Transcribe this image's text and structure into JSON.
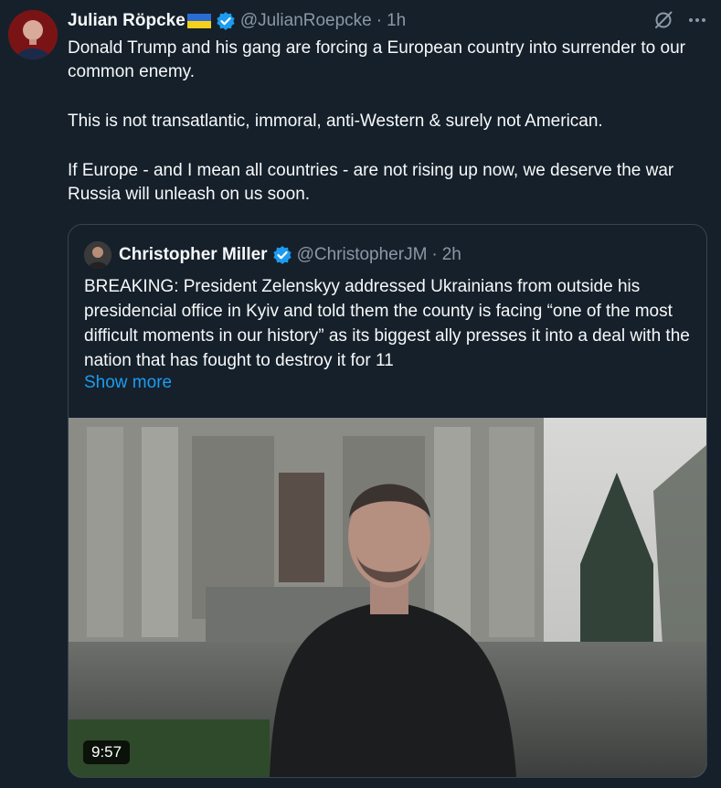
{
  "tweet": {
    "author_name": "Julian Röpcke",
    "author_handle": "@JulianRoepcke",
    "separator": "·",
    "time": "1h",
    "paragraphs": [
      "Donald Trump and his gang are forcing a European country into surrender to our common enemy.",
      "This is not transatlantic, immoral, anti-Western & surely not American.",
      "If Europe - and I mean all countries - are not rising up now, we deserve the war Russia will unleash on us soon."
    ],
    "icons": {
      "verified": "verified-badge-icon",
      "flag": "ukraine-flag-icon",
      "grok": "grok-icon",
      "more": "more-options-icon"
    }
  },
  "quote": {
    "author_name": "Christopher Miller",
    "author_handle": "@ChristopherJM",
    "separator": "·",
    "time": "2h",
    "text": "BREAKING: President Zelenskyy addressed Ukrainians from outside his presidencial office in Kyiv and told them the county is facing “one of the most difficult moments in our history” as its biggest ally presses it into a deal with the nation that has fought to destroy it for 11",
    "show_more": "Show more",
    "video_duration": "9:57"
  },
  "colors": {
    "background": "#15202b",
    "text": "#f7f9f9",
    "secondary": "#8b98a5",
    "link": "#1d9bf0",
    "border": "#38444d",
    "verified": "#1d9bf0"
  }
}
